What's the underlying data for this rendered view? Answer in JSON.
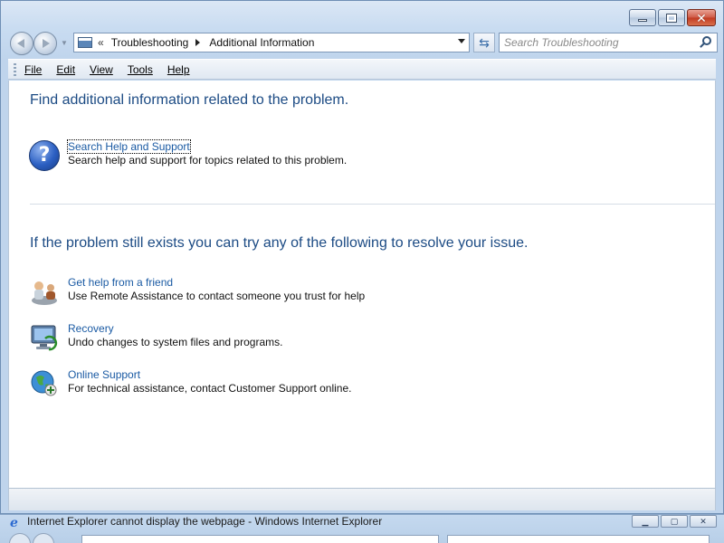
{
  "window": {
    "caption_buttons": [
      "minimize",
      "maximize",
      "close"
    ]
  },
  "navigation": {
    "breadcrumbs": [
      "Troubleshooting",
      "Additional Information"
    ],
    "overflow_chevron": "«",
    "search_placeholder": "Search Troubleshooting"
  },
  "menu": {
    "items": [
      "File",
      "Edit",
      "View",
      "Tools",
      "Help"
    ]
  },
  "content": {
    "heading1": "Find additional information related to the problem.",
    "help_task": {
      "link": "Search Help and Support",
      "description": "Search help and support for topics related to this problem.",
      "icon": "help-question-icon"
    },
    "heading2": "If the problem still exists you can try any of the following to resolve your issue.",
    "tasks": [
      {
        "link": "Get help from a friend",
        "description": "Use Remote Assistance to contact someone you trust for help",
        "icon": "remote-assistance-icon"
      },
      {
        "link": "Recovery",
        "description": "Undo changes to system files and programs.",
        "icon": "recovery-icon"
      },
      {
        "link": "Online Support",
        "description": "For technical assistance, contact Customer Support online.",
        "icon": "online-support-globe-icon"
      }
    ]
  },
  "background_window": {
    "title": "Internet Explorer cannot display the webpage - Windows Internet Explorer"
  },
  "colors": {
    "link": "#1a5aa3",
    "heading": "#1c4b84",
    "close_button": "#c13a22"
  }
}
